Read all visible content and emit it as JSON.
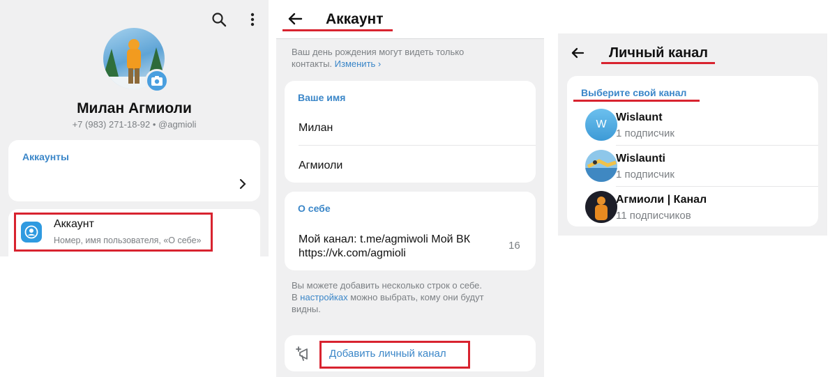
{
  "panel1": {
    "profile_name": "Милан Агмиоли",
    "profile_meta": "+7 (983) 271-18-92 • @agmioli",
    "accounts_header": "Аккаунты",
    "account_item": {
      "title": "Аккаунт",
      "subtitle": "Номер, имя пользователя, «О себе»"
    },
    "icons": [
      "search-icon",
      "more-vertical-icon",
      "camera-icon",
      "chevron-right-icon",
      "account-icon"
    ]
  },
  "panel2": {
    "title": "Аккаунт",
    "birthday_note": "Ваш день рождения могут видеть только",
    "birthday_note_2": "контакты.",
    "birthday_link": "Изменить",
    "name_section_header": "Ваше имя",
    "first_name": "Милан",
    "last_name": "Агмиоли",
    "about_header": "О себе",
    "about_text_1": "Мой канал: t.me/agmiwoli Мой ВК",
    "about_text_2": "https://vk.com/agmioli",
    "about_counter": "16",
    "about_hint_1": "Вы можете добавить несколько строк о себе.",
    "about_hint_2a": "В",
    "about_hint_link": "настройках",
    "about_hint_2b": "можно выбрать, кому они будут",
    "about_hint_3": "видны.",
    "add_channel_label": "Добавить личный канал"
  },
  "panel3": {
    "title": "Личный канал",
    "section_header": "Выберите свой канал",
    "channels": [
      {
        "name": "Wislaunt",
        "subs": "1 подписчик",
        "avatar_letter": "W"
      },
      {
        "name": "Wislaunti",
        "subs": "1 подписчик"
      },
      {
        "name": "Агмиоли | Канал",
        "subs": "11 подписчиков"
      }
    ]
  },
  "colors": {
    "accent": "#3a86c8",
    "highlight": "#d8232f",
    "background": "#f0f0f1"
  }
}
